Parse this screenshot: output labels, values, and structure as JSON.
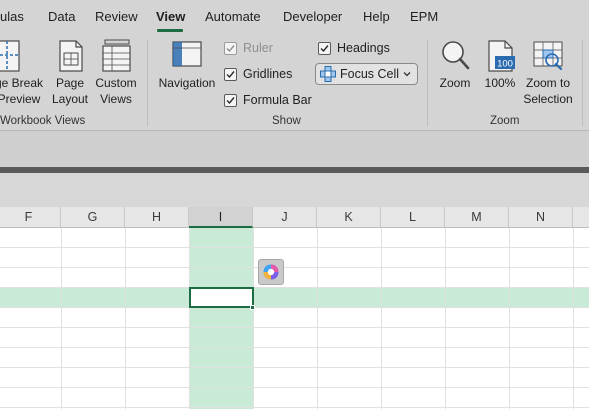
{
  "menu": {
    "tabs": [
      {
        "label": "ulas",
        "active": false
      },
      {
        "label": "Data",
        "active": false
      },
      {
        "label": "Review",
        "active": false
      },
      {
        "label": "View",
        "active": true
      },
      {
        "label": "Automate",
        "active": false
      },
      {
        "label": "Developer",
        "active": false
      },
      {
        "label": "Help",
        "active": false
      },
      {
        "label": "EPM",
        "active": false
      }
    ]
  },
  "ribbon": {
    "workbook_views": {
      "group_label": "Workbook Views",
      "page_break": {
        "line1": "ge Break",
        "line2": "Preview"
      },
      "page_layout": {
        "line1": "Page",
        "line2": "Layout"
      },
      "custom_views": {
        "line1": "Custom",
        "line2": "Views"
      }
    },
    "show": {
      "group_label": "Show",
      "navigation": "Navigation",
      "ruler": {
        "label": "Ruler",
        "checked": true,
        "disabled": true
      },
      "gridlines": {
        "label": "Gridlines",
        "checked": true
      },
      "formula_bar": {
        "label": "Formula Bar",
        "checked": true
      },
      "headings": {
        "label": "Headings",
        "checked": true
      },
      "focus_cell": "Focus Cell"
    },
    "zoom": {
      "group_label": "Zoom",
      "zoom": "Zoom",
      "hundred": "100%",
      "hundred_icon_text": "100",
      "zoom_to_selection": {
        "line1": "Zoom to",
        "line2": "Selection"
      }
    }
  },
  "grid": {
    "columns": [
      "F",
      "G",
      "H",
      "I",
      "J",
      "K",
      "L",
      "M",
      "N"
    ],
    "selected_column": "I",
    "accent_color": "#1e6c41",
    "highlight_color": "#c8ead6"
  }
}
